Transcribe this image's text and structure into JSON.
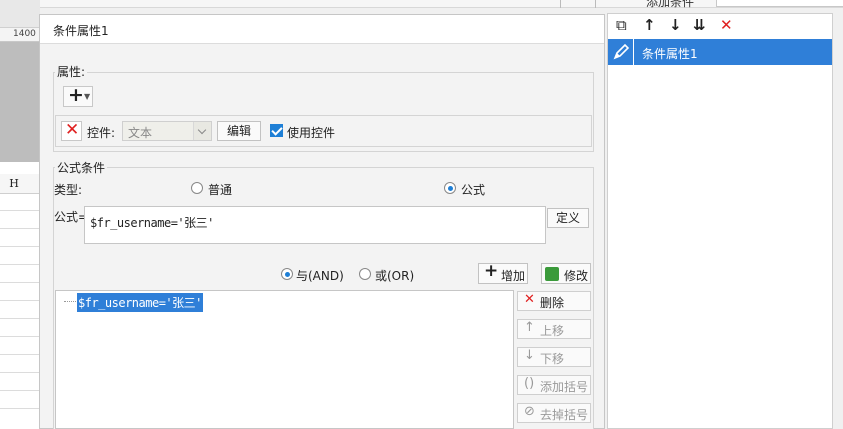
{
  "background_sheet": {
    "ruler_value": "1400",
    "column_header": "H"
  },
  "top_bar": {
    "dots": "···",
    "label": "添加条件"
  },
  "dialog": {
    "title": "条件属性1",
    "attributes_group": {
      "label": "属性:",
      "add_symbol": "+",
      "control_label": "控件:",
      "control_value": "文本",
      "edit_button": "编辑",
      "use_control_checked": true,
      "use_control_label": "使用控件"
    },
    "formula_group": {
      "label": "公式条件",
      "type_label": "类型:",
      "type_options": [
        "普通",
        "公式"
      ],
      "type_selected": "公式",
      "formula_label": "公式=",
      "formula_value": "$fr_username='张三'",
      "define_button": "定义",
      "logic_options": [
        "与(AND)",
        "或(OR)"
      ],
      "logic_selected": "与(AND)",
      "add_button": "增加",
      "modify_button": "修改",
      "conditions": [
        "$fr_username='张三'"
      ],
      "side_buttons": {
        "delete": "删除",
        "move_up": "上移",
        "move_down": "下移",
        "add_bracket": "添加括号",
        "remove_bracket": "去掉括号"
      }
    }
  },
  "right_panel": {
    "toolbar_icons": [
      "copy-icon",
      "arrow-up-icon",
      "arrow-down-icon",
      "move-bottom-icon",
      "delete-icon"
    ],
    "items": [
      "条件属性1"
    ],
    "accent_color": "#2f7fd8"
  }
}
